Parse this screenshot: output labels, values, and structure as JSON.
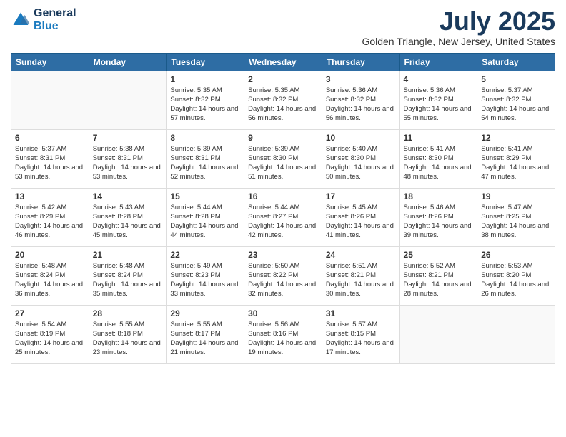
{
  "header": {
    "logo_general": "General",
    "logo_blue": "Blue",
    "month_title": "July 2025",
    "location": "Golden Triangle, New Jersey, United States"
  },
  "weekdays": [
    "Sunday",
    "Monday",
    "Tuesday",
    "Wednesday",
    "Thursday",
    "Friday",
    "Saturday"
  ],
  "weeks": [
    [
      {
        "day": "",
        "sunrise": "",
        "sunset": "",
        "daylight": ""
      },
      {
        "day": "",
        "sunrise": "",
        "sunset": "",
        "daylight": ""
      },
      {
        "day": "1",
        "sunrise": "Sunrise: 5:35 AM",
        "sunset": "Sunset: 8:32 PM",
        "daylight": "Daylight: 14 hours and 57 minutes."
      },
      {
        "day": "2",
        "sunrise": "Sunrise: 5:35 AM",
        "sunset": "Sunset: 8:32 PM",
        "daylight": "Daylight: 14 hours and 56 minutes."
      },
      {
        "day": "3",
        "sunrise": "Sunrise: 5:36 AM",
        "sunset": "Sunset: 8:32 PM",
        "daylight": "Daylight: 14 hours and 56 minutes."
      },
      {
        "day": "4",
        "sunrise": "Sunrise: 5:36 AM",
        "sunset": "Sunset: 8:32 PM",
        "daylight": "Daylight: 14 hours and 55 minutes."
      },
      {
        "day": "5",
        "sunrise": "Sunrise: 5:37 AM",
        "sunset": "Sunset: 8:32 PM",
        "daylight": "Daylight: 14 hours and 54 minutes."
      }
    ],
    [
      {
        "day": "6",
        "sunrise": "Sunrise: 5:37 AM",
        "sunset": "Sunset: 8:31 PM",
        "daylight": "Daylight: 14 hours and 53 minutes."
      },
      {
        "day": "7",
        "sunrise": "Sunrise: 5:38 AM",
        "sunset": "Sunset: 8:31 PM",
        "daylight": "Daylight: 14 hours and 53 minutes."
      },
      {
        "day": "8",
        "sunrise": "Sunrise: 5:39 AM",
        "sunset": "Sunset: 8:31 PM",
        "daylight": "Daylight: 14 hours and 52 minutes."
      },
      {
        "day": "9",
        "sunrise": "Sunrise: 5:39 AM",
        "sunset": "Sunset: 8:30 PM",
        "daylight": "Daylight: 14 hours and 51 minutes."
      },
      {
        "day": "10",
        "sunrise": "Sunrise: 5:40 AM",
        "sunset": "Sunset: 8:30 PM",
        "daylight": "Daylight: 14 hours and 50 minutes."
      },
      {
        "day": "11",
        "sunrise": "Sunrise: 5:41 AM",
        "sunset": "Sunset: 8:30 PM",
        "daylight": "Daylight: 14 hours and 48 minutes."
      },
      {
        "day": "12",
        "sunrise": "Sunrise: 5:41 AM",
        "sunset": "Sunset: 8:29 PM",
        "daylight": "Daylight: 14 hours and 47 minutes."
      }
    ],
    [
      {
        "day": "13",
        "sunrise": "Sunrise: 5:42 AM",
        "sunset": "Sunset: 8:29 PM",
        "daylight": "Daylight: 14 hours and 46 minutes."
      },
      {
        "day": "14",
        "sunrise": "Sunrise: 5:43 AM",
        "sunset": "Sunset: 8:28 PM",
        "daylight": "Daylight: 14 hours and 45 minutes."
      },
      {
        "day": "15",
        "sunrise": "Sunrise: 5:44 AM",
        "sunset": "Sunset: 8:28 PM",
        "daylight": "Daylight: 14 hours and 44 minutes."
      },
      {
        "day": "16",
        "sunrise": "Sunrise: 5:44 AM",
        "sunset": "Sunset: 8:27 PM",
        "daylight": "Daylight: 14 hours and 42 minutes."
      },
      {
        "day": "17",
        "sunrise": "Sunrise: 5:45 AM",
        "sunset": "Sunset: 8:26 PM",
        "daylight": "Daylight: 14 hours and 41 minutes."
      },
      {
        "day": "18",
        "sunrise": "Sunrise: 5:46 AM",
        "sunset": "Sunset: 8:26 PM",
        "daylight": "Daylight: 14 hours and 39 minutes."
      },
      {
        "day": "19",
        "sunrise": "Sunrise: 5:47 AM",
        "sunset": "Sunset: 8:25 PM",
        "daylight": "Daylight: 14 hours and 38 minutes."
      }
    ],
    [
      {
        "day": "20",
        "sunrise": "Sunrise: 5:48 AM",
        "sunset": "Sunset: 8:24 PM",
        "daylight": "Daylight: 14 hours and 36 minutes."
      },
      {
        "day": "21",
        "sunrise": "Sunrise: 5:48 AM",
        "sunset": "Sunset: 8:24 PM",
        "daylight": "Daylight: 14 hours and 35 minutes."
      },
      {
        "day": "22",
        "sunrise": "Sunrise: 5:49 AM",
        "sunset": "Sunset: 8:23 PM",
        "daylight": "Daylight: 14 hours and 33 minutes."
      },
      {
        "day": "23",
        "sunrise": "Sunrise: 5:50 AM",
        "sunset": "Sunset: 8:22 PM",
        "daylight": "Daylight: 14 hours and 32 minutes."
      },
      {
        "day": "24",
        "sunrise": "Sunrise: 5:51 AM",
        "sunset": "Sunset: 8:21 PM",
        "daylight": "Daylight: 14 hours and 30 minutes."
      },
      {
        "day": "25",
        "sunrise": "Sunrise: 5:52 AM",
        "sunset": "Sunset: 8:21 PM",
        "daylight": "Daylight: 14 hours and 28 minutes."
      },
      {
        "day": "26",
        "sunrise": "Sunrise: 5:53 AM",
        "sunset": "Sunset: 8:20 PM",
        "daylight": "Daylight: 14 hours and 26 minutes."
      }
    ],
    [
      {
        "day": "27",
        "sunrise": "Sunrise: 5:54 AM",
        "sunset": "Sunset: 8:19 PM",
        "daylight": "Daylight: 14 hours and 25 minutes."
      },
      {
        "day": "28",
        "sunrise": "Sunrise: 5:55 AM",
        "sunset": "Sunset: 8:18 PM",
        "daylight": "Daylight: 14 hours and 23 minutes."
      },
      {
        "day": "29",
        "sunrise": "Sunrise: 5:55 AM",
        "sunset": "Sunset: 8:17 PM",
        "daylight": "Daylight: 14 hours and 21 minutes."
      },
      {
        "day": "30",
        "sunrise": "Sunrise: 5:56 AM",
        "sunset": "Sunset: 8:16 PM",
        "daylight": "Daylight: 14 hours and 19 minutes."
      },
      {
        "day": "31",
        "sunrise": "Sunrise: 5:57 AM",
        "sunset": "Sunset: 8:15 PM",
        "daylight": "Daylight: 14 hours and 17 minutes."
      },
      {
        "day": "",
        "sunrise": "",
        "sunset": "",
        "daylight": ""
      },
      {
        "day": "",
        "sunrise": "",
        "sunset": "",
        "daylight": ""
      }
    ]
  ]
}
